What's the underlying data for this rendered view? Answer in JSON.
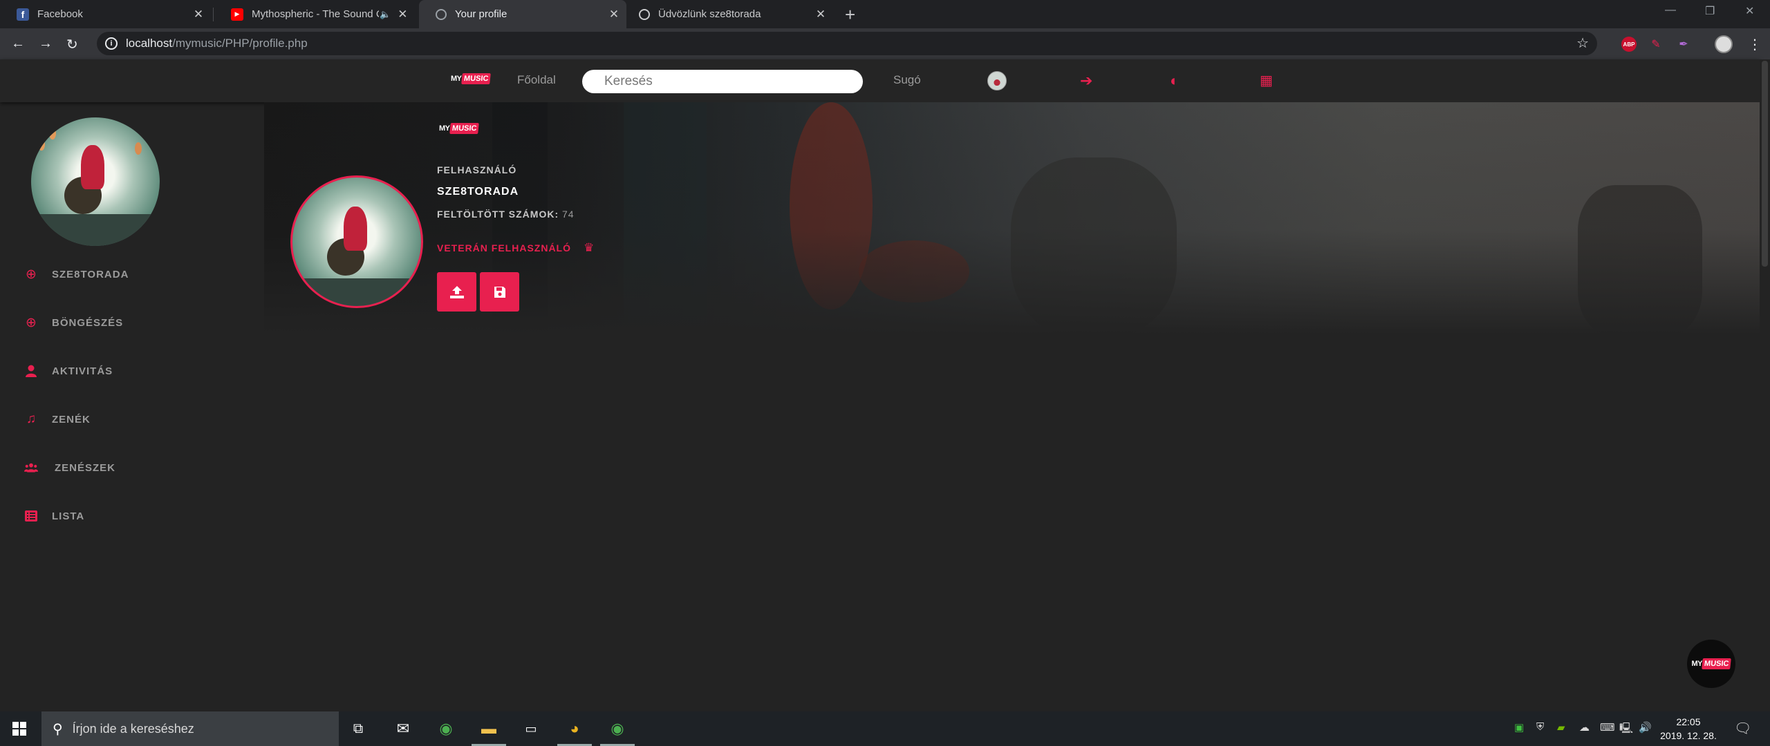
{
  "browser": {
    "tabs": [
      {
        "title": "Facebook",
        "active": false
      },
      {
        "title": "Mythospheric - The Sound C",
        "active": false
      },
      {
        "title": "Your profile",
        "active": true
      },
      {
        "title": "Üdvözlünk sze8torada",
        "active": false
      }
    ],
    "url_host": "localhost",
    "url_path": "/mymusic/PHP/profile.php",
    "extension_abp": "ABP"
  },
  "site": {
    "logo_my": "MY",
    "logo_music": "MUSIC",
    "nav_home": "Főoldal",
    "search_placeholder": "Keresés",
    "nav_help": "Sugó"
  },
  "sidebar": {
    "items": [
      {
        "label": "SZE8TORADA",
        "icon": "plus-circle-icon"
      },
      {
        "label": "BÖNGÉSZÉS",
        "icon": "plus-circle-icon"
      },
      {
        "label": "AKTIVITÁS",
        "icon": "user-icon"
      },
      {
        "label": "ZENÉK",
        "icon": "music-note-icon"
      },
      {
        "label": "ZENÉSZEK",
        "icon": "users-icon"
      },
      {
        "label": "LISTA",
        "icon": "list-icon"
      }
    ]
  },
  "profile": {
    "role_label": "FELHASZNÁLÓ",
    "username": "SZE8TORADA",
    "uploaded_label": "FELTÖLTÖTT SZÁMOK:",
    "uploaded_count": "74",
    "rank": "VETERÁN FELHASZNÁLÓ"
  },
  "taskbar": {
    "search_placeholder": "Írjon ide a kereséshez",
    "time": "22:05",
    "date": "2019. 12. 28."
  },
  "colors": {
    "accent": "#e8204f",
    "background": "#232323",
    "header": "#252525"
  }
}
